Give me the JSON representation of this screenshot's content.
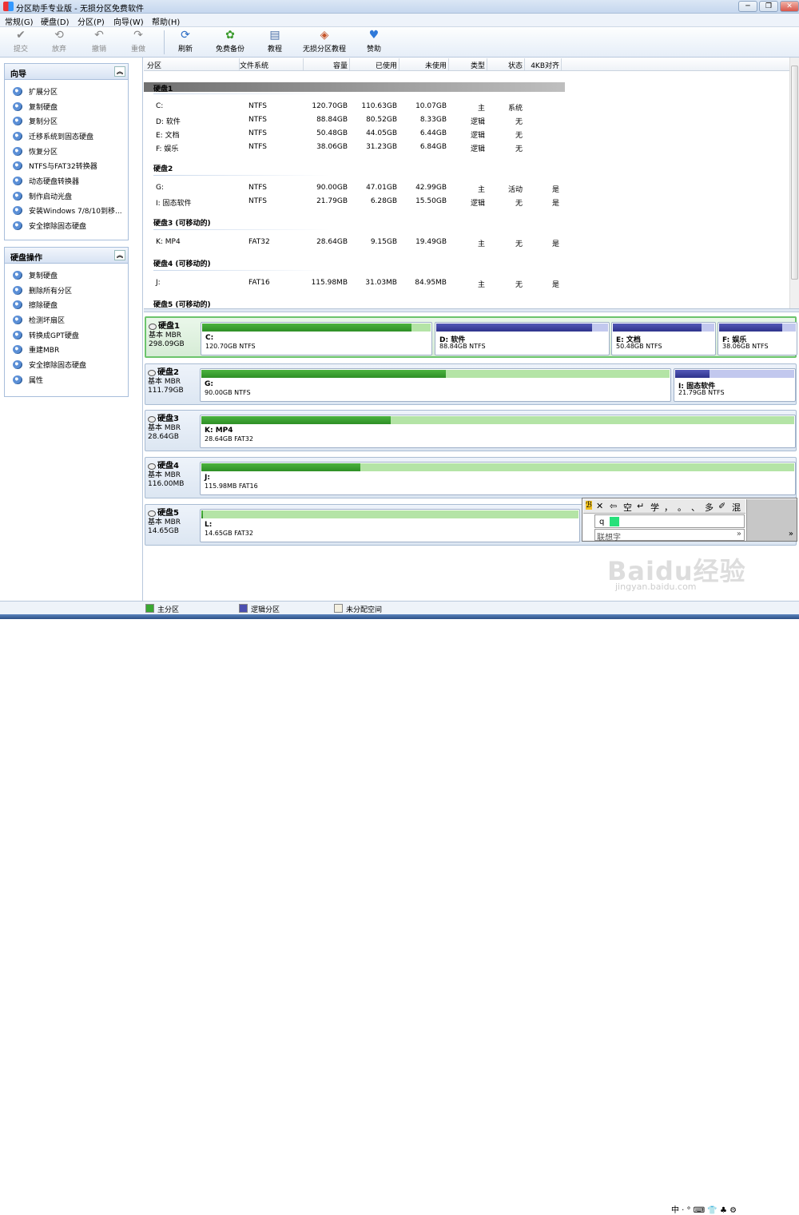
{
  "window": {
    "title": "分区助手专业版 - 无损分区免费软件",
    "controls": [
      "─",
      "❐",
      "✕"
    ]
  },
  "menu": [
    "常规(G)",
    "硬盘(D)",
    "分区(P)",
    "向导(W)",
    "帮助(H)"
  ],
  "toolbar": [
    {
      "label": "提交",
      "icon": "check-icon",
      "glyph": "✔",
      "enabled": false
    },
    {
      "label": "放弃",
      "icon": "discard-icon",
      "glyph": "⟲",
      "enabled": false
    },
    {
      "label": "撤销",
      "icon": "undo-icon",
      "glyph": "↶",
      "enabled": false
    },
    {
      "label": "重做",
      "icon": "redo-icon",
      "glyph": "↷",
      "enabled": false
    },
    {
      "label": "刷新",
      "icon": "refresh-icon",
      "glyph": "⟳",
      "enabled": true
    },
    {
      "label": "免费备份",
      "icon": "backup-icon",
      "glyph": "✿",
      "enabled": true
    },
    {
      "label": "教程",
      "icon": "tutorial-icon",
      "glyph": "▤",
      "enabled": true
    },
    {
      "label": "无损分区教程",
      "icon": "partition-tutorial-icon",
      "glyph": "◈",
      "enabled": true
    },
    {
      "label": "赞助",
      "icon": "heart-icon",
      "glyph": "♥",
      "enabled": true
    }
  ],
  "wizard_panel": {
    "title": "向导",
    "items": [
      "扩展分区",
      "复制硬盘",
      "复制分区",
      "迁移系统到固态硬盘",
      "恢复分区",
      "NTFS与FAT32转换器",
      "动态硬盘转换器",
      "制作启动光盘",
      "安装Windows 7/8/10到移...",
      "安全擦除固态硬盘"
    ]
  },
  "disk_ops_panel": {
    "title": "硬盘操作",
    "items": [
      "复制硬盘",
      "删除所有分区",
      "擦除硬盘",
      "检测坏扇区",
      "转换成GPT硬盘",
      "重建MBR",
      "安全擦除固态硬盘",
      "属性"
    ]
  },
  "table": {
    "columns": [
      "分区",
      "文件系统",
      "容量",
      "已使用",
      "未使用",
      "类型",
      "状态",
      "4KB对齐"
    ],
    "disks": [
      {
        "name": "硬盘1",
        "highlighted": true,
        "rows": [
          [
            "C:",
            "NTFS",
            "120.70GB",
            "110.63GB",
            "10.07GB",
            "主",
            "系统",
            ""
          ],
          [
            "D: 软件",
            "NTFS",
            "88.84GB",
            "80.52GB",
            "8.33GB",
            "逻辑",
            "无",
            ""
          ],
          [
            "E: 文档",
            "NTFS",
            "50.48GB",
            "44.05GB",
            "6.44GB",
            "逻辑",
            "无",
            ""
          ],
          [
            "F: 娱乐",
            "NTFS",
            "38.06GB",
            "31.23GB",
            "6.84GB",
            "逻辑",
            "无",
            ""
          ]
        ]
      },
      {
        "name": "硬盘2",
        "highlighted": false,
        "rows": [
          [
            "G:",
            "NTFS",
            "90.00GB",
            "47.01GB",
            "42.99GB",
            "主",
            "活动",
            "是"
          ],
          [
            "I: 固态软件",
            "NTFS",
            "21.79GB",
            "6.28GB",
            "15.50GB",
            "逻辑",
            "无",
            "是"
          ]
        ]
      },
      {
        "name": "硬盘3 (可移动的)",
        "highlighted": false,
        "rows": [
          [
            "K: MP4",
            "FAT32",
            "28.64GB",
            "9.15GB",
            "19.49GB",
            "主",
            "无",
            "是"
          ]
        ]
      },
      {
        "name": "硬盘4 (可移动的)",
        "highlighted": false,
        "rows": [
          [
            "J:",
            "FAT16",
            "115.98MB",
            "31.03MB",
            "84.95MB",
            "主",
            "无",
            "是"
          ]
        ]
      },
      {
        "name": "硬盘5 (可移动的)",
        "highlighted": false,
        "rows": []
      }
    ]
  },
  "disk_map": [
    {
      "name": "硬盘1",
      "type": "基本 MBR",
      "size": "298.09GB",
      "selected": true,
      "parts": [
        {
          "name": "C:",
          "info": "120.70GB NTFS",
          "used": 0.917,
          "kind": "primary"
        },
        {
          "name": "D: 软件",
          "info": "88.84GB NTFS",
          "used": 0.906,
          "kind": "logical"
        },
        {
          "name": "E: 文档",
          "info": "50.48GB NTFS",
          "used": 0.873,
          "kind": "logical"
        },
        {
          "name": "F: 娱乐",
          "info": "38.06GB NTFS",
          "used": 0.821,
          "kind": "logical"
        }
      ]
    },
    {
      "name": "硬盘2",
      "type": "基本 MBR",
      "size": "111.79GB",
      "selected": false,
      "parts": [
        {
          "name": "G:",
          "info": "90.00GB NTFS",
          "used": 0.522,
          "kind": "primary"
        },
        {
          "name": "I: 固态软件",
          "info": "21.79GB NTFS",
          "used": 0.288,
          "kind": "logical"
        }
      ]
    },
    {
      "name": "硬盘3",
      "type": "基本 MBR",
      "size": "28.64GB",
      "selected": false,
      "parts": [
        {
          "name": "K: MP4",
          "info": "28.64GB FAT32",
          "used": 0.319,
          "kind": "primary"
        }
      ]
    },
    {
      "name": "硬盘4",
      "type": "基本 MBR",
      "size": "116.00MB",
      "selected": false,
      "parts": [
        {
          "name": "J:",
          "info": "115.98MB FAT16",
          "used": 0.268,
          "kind": "primary"
        }
      ]
    },
    {
      "name": "硬盘5",
      "type": "基本 MBR",
      "size": "14.65GB",
      "selected": false,
      "parts": [
        {
          "name": "L:",
          "info": "14.65GB FAT32",
          "used": 0.005,
          "kind": "primary"
        }
      ]
    }
  ],
  "legend": [
    {
      "label": "主分区",
      "color": "#3aa832"
    },
    {
      "label": "逻辑分区",
      "color": "#4b4fb0"
    },
    {
      "label": "未分配空间",
      "color": "#f4f0e0"
    }
  ],
  "ime": {
    "toolbar": [
      "✕",
      "⇦",
      "空",
      "↵",
      "学",
      "，",
      "。",
      "、",
      "多",
      "✐",
      "混"
    ],
    "typed": "q",
    "assoc_placeholder": "联想字",
    "more": "»"
  },
  "watermark": {
    "brand": "Baidu经验",
    "url": "jingyan.baidu.com"
  },
  "tray": "中 · ° ⌨ 👕 ♣ ⚙"
}
